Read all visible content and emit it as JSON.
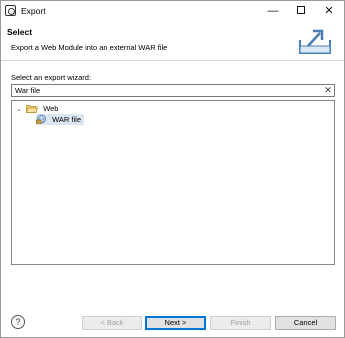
{
  "window": {
    "title": "Export",
    "minimize_label": "—",
    "close_label": "✕"
  },
  "header": {
    "title": "Select",
    "description": "Export a Web Module into an external WAR file"
  },
  "wizard": {
    "label": "Select an export wizard:",
    "filter_value": "War file",
    "clear_label": "✕",
    "tree": [
      {
        "label": "Web",
        "expanded": true,
        "icon": "folder-open-icon",
        "children": [
          {
            "label": "WAR file",
            "selected": true,
            "icon": "war-file-icon"
          }
        ]
      }
    ],
    "twisty": "⌄"
  },
  "footer": {
    "help_label": "?",
    "back_label": "< Back",
    "next_label": "Next >",
    "finish_label": "Finish",
    "cancel_label": "Cancel"
  },
  "colors": {
    "selection": "#dde6f3",
    "default_button_border": "#0078d7",
    "folder": "#e8c25a"
  }
}
